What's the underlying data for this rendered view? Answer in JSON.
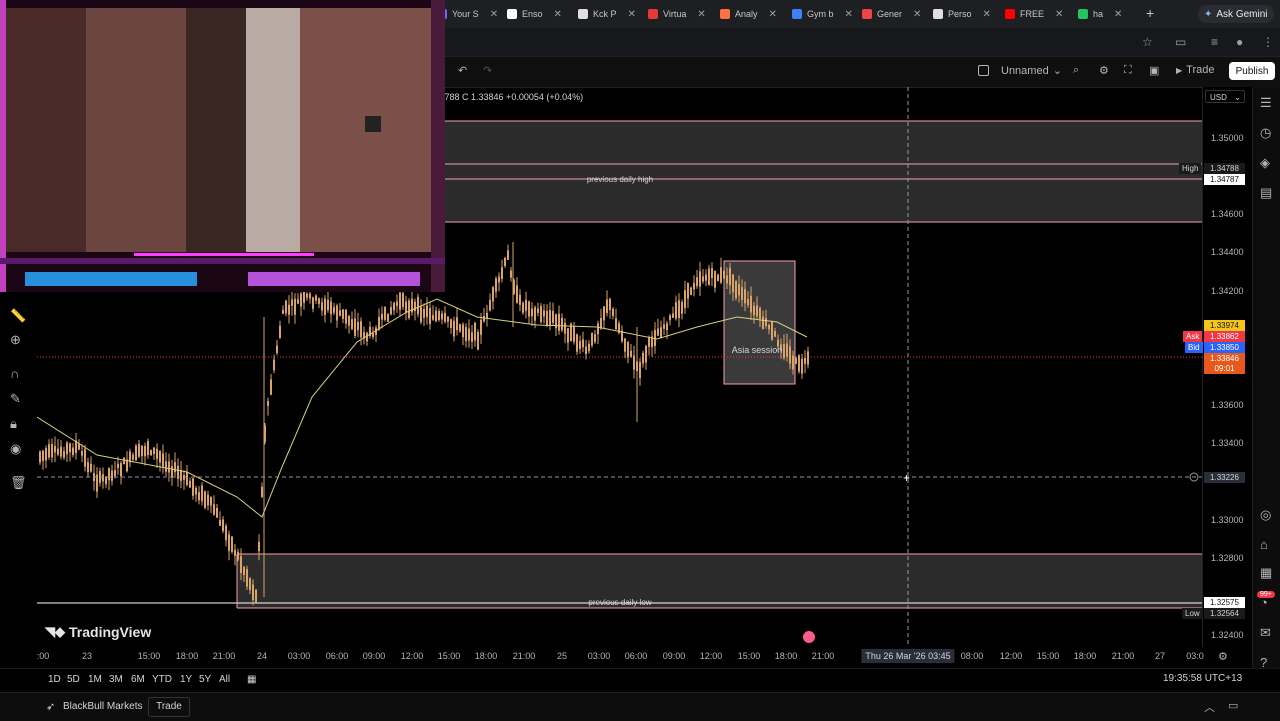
{
  "browser": {
    "tabs": [
      {
        "label": "Your S",
        "color": "#7b61ff"
      },
      {
        "label": "Enso",
        "color": "#ffffff"
      },
      {
        "label": "Kck P",
        "color": "#e0e0e0"
      },
      {
        "label": "Virtua",
        "color": "#e53935"
      },
      {
        "label": "Analy",
        "color": "#ff7043"
      },
      {
        "label": "Gym b",
        "color": "#3b82f6"
      },
      {
        "label": "Gener",
        "color": "#ef4444"
      },
      {
        "label": "Perso",
        "color": "#e0e0e0"
      },
      {
        "label": "FREE",
        "color": "#ff0000"
      },
      {
        "label": "ha",
        "color": "#22c55e"
      }
    ],
    "new_tab": "+",
    "ask_gemini": "Ask Gemini"
  },
  "tv_header": {
    "layout_name": "Unnamed",
    "trade_label": "Trade",
    "publish_label": "Publish"
  },
  "legend": {
    "ohlc": ".33788 C 1.33846 +0.00054 (+0.04%)"
  },
  "price_axis": {
    "currency": "USD",
    "ticks": [
      "1.35000",
      "1.34600",
      "1.34400",
      "1.34200",
      "1.33600",
      "1.33400",
      "1.33000",
      "1.32800",
      "1.32400"
    ],
    "high_label": "High",
    "high_values": [
      "1.34788",
      "1.34787"
    ],
    "current_yellow": "1.33974",
    "ask_label": "Ask",
    "ask_value": "1.33862",
    "bid_label": "Bid",
    "bid_value": "1.33850",
    "last_price": "1.33846",
    "countdown": "09:01",
    "crosshair_price": "1.33226",
    "low_label": "Low",
    "low_values": [
      "1.32575",
      "1.32564"
    ]
  },
  "annotations": {
    "prev_high": "previous daily high",
    "prev_low": "previous daily low",
    "asia": "Asia session"
  },
  "time_axis": {
    "ticks": [
      {
        "label": ":00"
      },
      {
        "label": "23"
      },
      {
        "label": "15:00"
      },
      {
        "label": "18:00"
      },
      {
        "label": "21:00"
      },
      {
        "label": "24"
      },
      {
        "label": "03:00"
      },
      {
        "label": "06:00"
      },
      {
        "label": "09:00"
      },
      {
        "label": "12:00"
      },
      {
        "label": "15:00"
      },
      {
        "label": "18:00"
      },
      {
        "label": "21:00"
      },
      {
        "label": "25"
      },
      {
        "label": "03:00"
      },
      {
        "label": "06:00"
      },
      {
        "label": "09:00"
      },
      {
        "label": "12:00"
      },
      {
        "label": "15:00"
      },
      {
        "label": "18:00"
      },
      {
        "label": "21:00"
      },
      {
        "label": "08:00"
      },
      {
        "label": "12:00"
      },
      {
        "label": "15:00"
      },
      {
        "label": "18:00"
      },
      {
        "label": "21:00"
      },
      {
        "label": "27"
      },
      {
        "label": "03:0"
      }
    ],
    "cursor_label": "Thu 26 Mar '26   03:45"
  },
  "ranges": [
    "1D",
    "5D",
    "1M",
    "3M",
    "6M",
    "YTD",
    "1Y",
    "5Y",
    "All"
  ],
  "clock": "19:35:58 UTC+13",
  "brand": "TradingView",
  "broker": {
    "name": "BlackBull Markets",
    "trade": "Trade"
  },
  "badge_count": "99+",
  "colors": {
    "zone_border": "#f7a1b0",
    "zone_fill": "#2b2b2b",
    "candle": "#d9a36a",
    "ma_line": "#d6d080",
    "ask": "#f23645",
    "bid": "#2962ff",
    "last": "#e8581c",
    "yellow_tag": "#f5c518"
  }
}
